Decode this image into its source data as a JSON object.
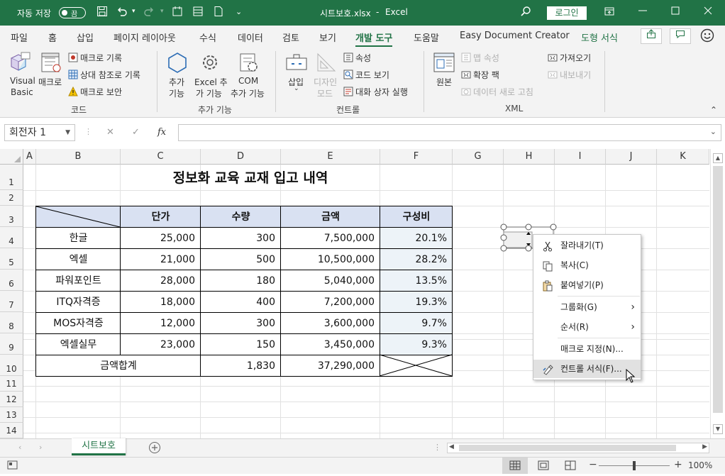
{
  "titlebar": {
    "autosave_label": "자동 저장",
    "toggle_state": "끔",
    "filename": "시트보호.xlsx",
    "dash": "-",
    "app": "Excel",
    "login": "로그인"
  },
  "tabs": [
    "파일",
    "홈",
    "삽입",
    "페이지 레이아웃",
    "수식",
    "데이터",
    "검토",
    "보기",
    "개발 도구",
    "도움말",
    "Easy Document Creator",
    "도형 서식"
  ],
  "ribbon": {
    "code": {
      "visual_basic_1": "Visual",
      "visual_basic_2": "Basic",
      "macro": "매크로",
      "record_macro": "매크로 기록",
      "relative_ref": "상대 참조로 기록",
      "macro_security": "매크로 보안",
      "group_label": "코드"
    },
    "addins": {
      "addins_1": "추가",
      "addins_2": "기능",
      "excel_addins_1": "Excel 추",
      "excel_addins_2": "가 기능",
      "com_1": "COM",
      "com_2": "추가 기능",
      "group_label": "추가 기능"
    },
    "controls": {
      "insert": "삽입",
      "design_1": "디자인",
      "design_2": "모드",
      "properties": "속성",
      "view_code": "코드 보기",
      "run_dialog": "대화 상자 실행",
      "group_label": "컨트롤"
    },
    "xml": {
      "source": "원본",
      "map_props": "맵 속성",
      "expansion_packs": "확장 팩",
      "refresh_data": "데이터 새로 고침",
      "import": "가져오기",
      "export": "내보내기",
      "group_label": "XML"
    }
  },
  "formula_bar": {
    "name_box": "회전자 1",
    "cancel": "✕",
    "enter": "✓",
    "fx": "fx",
    "value": ""
  },
  "columns": [
    "A",
    "B",
    "C",
    "D",
    "E",
    "F",
    "G",
    "H",
    "I",
    "J",
    "K"
  ],
  "rows": [
    "1",
    "2",
    "3",
    "4",
    "5",
    "6",
    "7",
    "8",
    "9",
    "10",
    "11",
    "12",
    "13",
    "14"
  ],
  "sheet": {
    "title": "정보화 교육 교재 입고 내역",
    "headers": [
      "단가",
      "수량",
      "금액",
      "구성비"
    ],
    "data": [
      [
        "한글",
        "25,000",
        "300",
        "7,500,000",
        "20.1%"
      ],
      [
        "엑셀",
        "21,000",
        "500",
        "10,500,000",
        "28.2%"
      ],
      [
        "파워포인트",
        "28,000",
        "180",
        "5,040,000",
        "13.5%"
      ],
      [
        "ITQ자격증",
        "18,000",
        "400",
        "7,200,000",
        "19.3%"
      ],
      [
        "MOS자격증",
        "12,000",
        "300",
        "3,600,000",
        "9.7%"
      ],
      [
        "엑셀실무",
        "23,000",
        "150",
        "3,450,000",
        "9.3%"
      ]
    ],
    "total_label": "금액합계",
    "total_qty": "1,830",
    "total_amount": "37,290,000"
  },
  "context_menu": {
    "cut": "잘라내기(T)",
    "copy": "복사(C)",
    "paste": "붙여넣기(P)",
    "group": "그룹화(G)",
    "order": "순서(R)",
    "assign_macro": "매크로 지정(N)...",
    "format_control": "컨트롤 서식(F)..."
  },
  "sheet_tabs": {
    "active": "시트보호"
  },
  "status": {
    "zoom": "100%",
    "minus": "−",
    "plus": "+"
  },
  "colors": {
    "excel_green": "#217346",
    "header_fill": "#d9e1f2",
    "ratio_fill": "#edf3f8"
  }
}
